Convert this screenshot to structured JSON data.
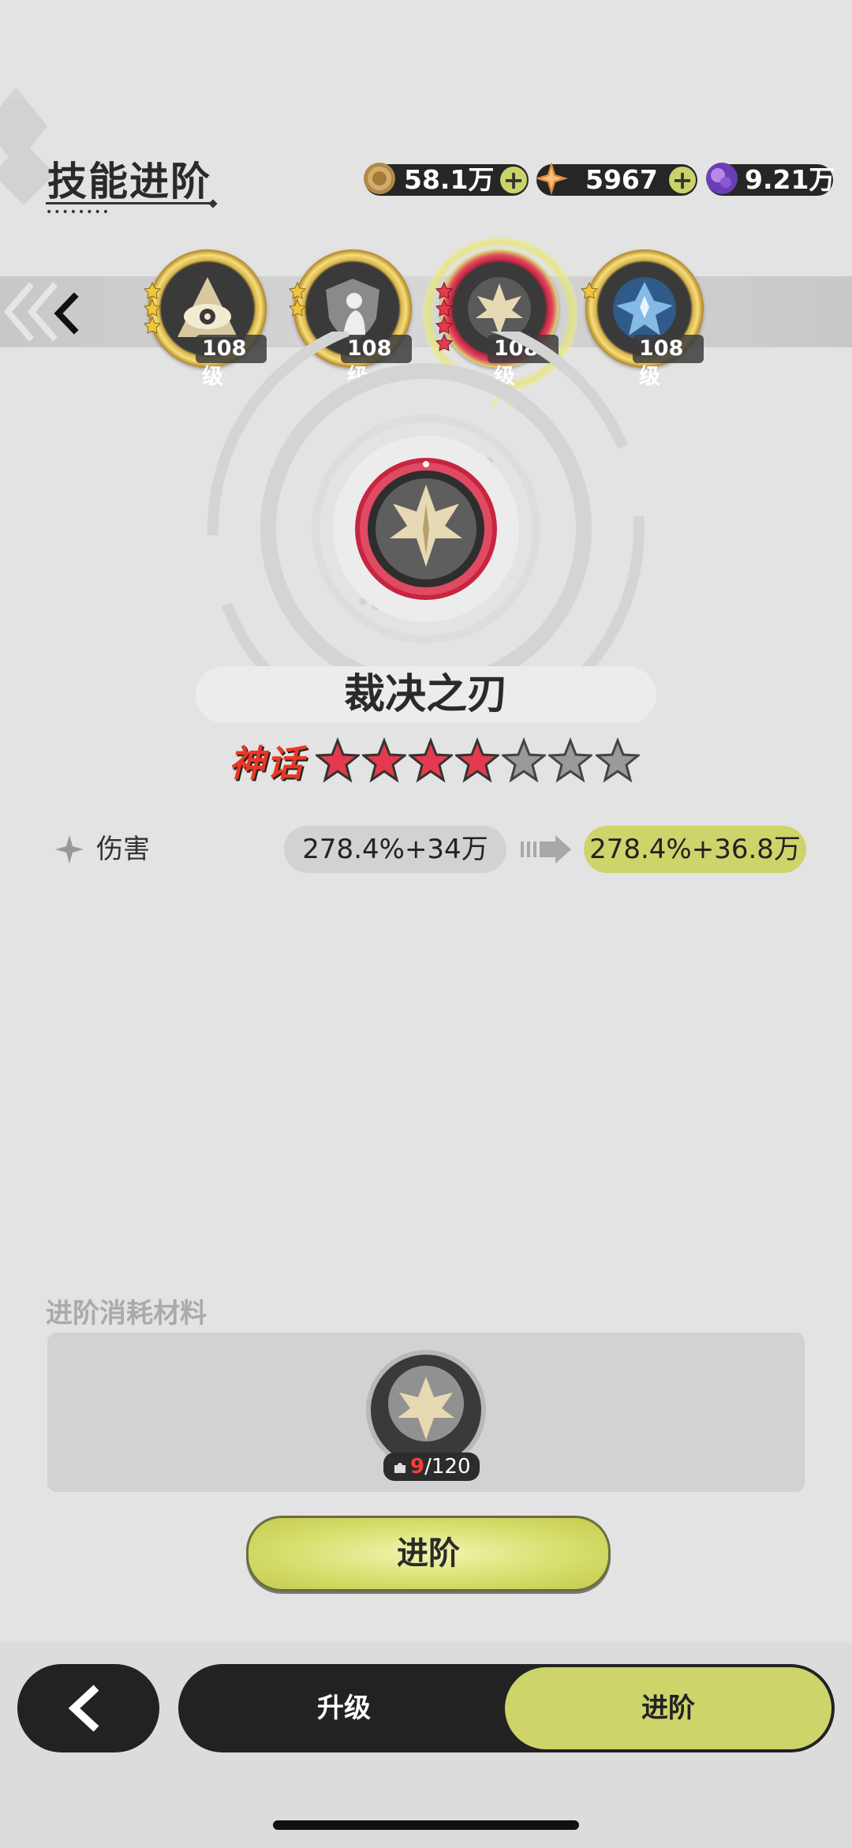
{
  "header": {
    "title": "技能进阶"
  },
  "currencies": [
    {
      "name": "coin",
      "value": "58.1万",
      "icon": "coin-icon",
      "has_plus": true
    },
    {
      "name": "star-shard",
      "value": "5967",
      "icon": "star-shard-icon",
      "has_plus": true
    },
    {
      "name": "crystal",
      "value": "9.21万",
      "icon": "crystal-icon",
      "has_plus": false
    }
  ],
  "skill_strip": {
    "skills": [
      {
        "icon": "eye-skill-icon",
        "level": "108级",
        "stars": 3,
        "frame": "gold"
      },
      {
        "icon": "shield-figure-skill-icon",
        "level": "108级",
        "stars": 2,
        "frame": "gold"
      },
      {
        "icon": "maple-leaf-skill-icon",
        "level": "108级",
        "stars": 4,
        "frame": "red",
        "selected": true
      },
      {
        "icon": "blue-emblem-skill-icon",
        "level": "108级",
        "stars": 1,
        "frame": "gold"
      }
    ]
  },
  "skill": {
    "name": "裁决之刃",
    "rarity": "神话",
    "stars_filled": 4,
    "stars_total": 7
  },
  "stat": {
    "label": "伤害",
    "current": "278.4%+34万",
    "next": "278.4%+36.8万"
  },
  "materials": {
    "label": "进阶消耗材料",
    "item_icon": "maple-leaf-shard-icon",
    "have": "9",
    "need": "/120"
  },
  "actions": {
    "advance_label": "进阶"
  },
  "bottom_tabs": {
    "upgrade_label": "升级",
    "advance_label": "进阶",
    "active": "advance"
  },
  "colors": {
    "accent": "#cdd46a",
    "rarity": "#e83824",
    "star_red": "#e43a4e",
    "dark": "#222222"
  }
}
